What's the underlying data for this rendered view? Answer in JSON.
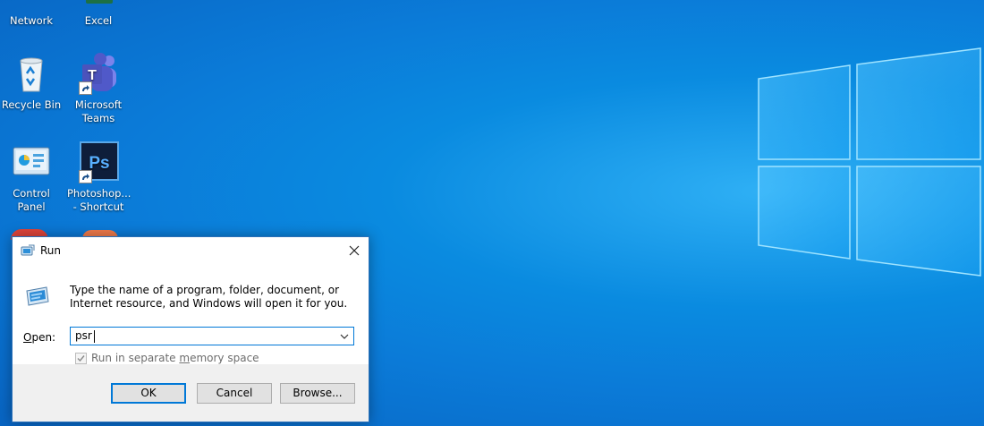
{
  "desktop": {
    "icons": [
      {
        "label": "Network",
        "icon": "network-icon"
      },
      {
        "label": "Excel",
        "icon": "excel-icon"
      },
      {
        "label": "Recycle Bin",
        "icon": "recycle-bin-icon"
      },
      {
        "label": "Microsoft\nTeams",
        "icon": "teams-icon"
      },
      {
        "label": "Control\nPanel",
        "icon": "control-panel-icon"
      },
      {
        "label": "Photoshop...\n- Shortcut",
        "icon": "photoshop-icon"
      }
    ]
  },
  "run_dialog": {
    "title": "Run",
    "description": "Type the name of a program, folder, document, or Internet resource, and Windows will open it for you.",
    "open_label_prefix": "",
    "open_label_accel": "O",
    "open_label_rest": "pen:",
    "open_value": "psr",
    "checkbox_label_before": "Run in separate ",
    "checkbox_label_accel": "m",
    "checkbox_label_after": "emory space",
    "checkbox_checked": true,
    "buttons": {
      "ok": "OK",
      "cancel": "Cancel",
      "browse": "Browse..."
    }
  },
  "colors": {
    "desktop_blue": "#0b7bd8",
    "dialog_border": "#2a70b8",
    "focus_blue": "#0078d7"
  }
}
